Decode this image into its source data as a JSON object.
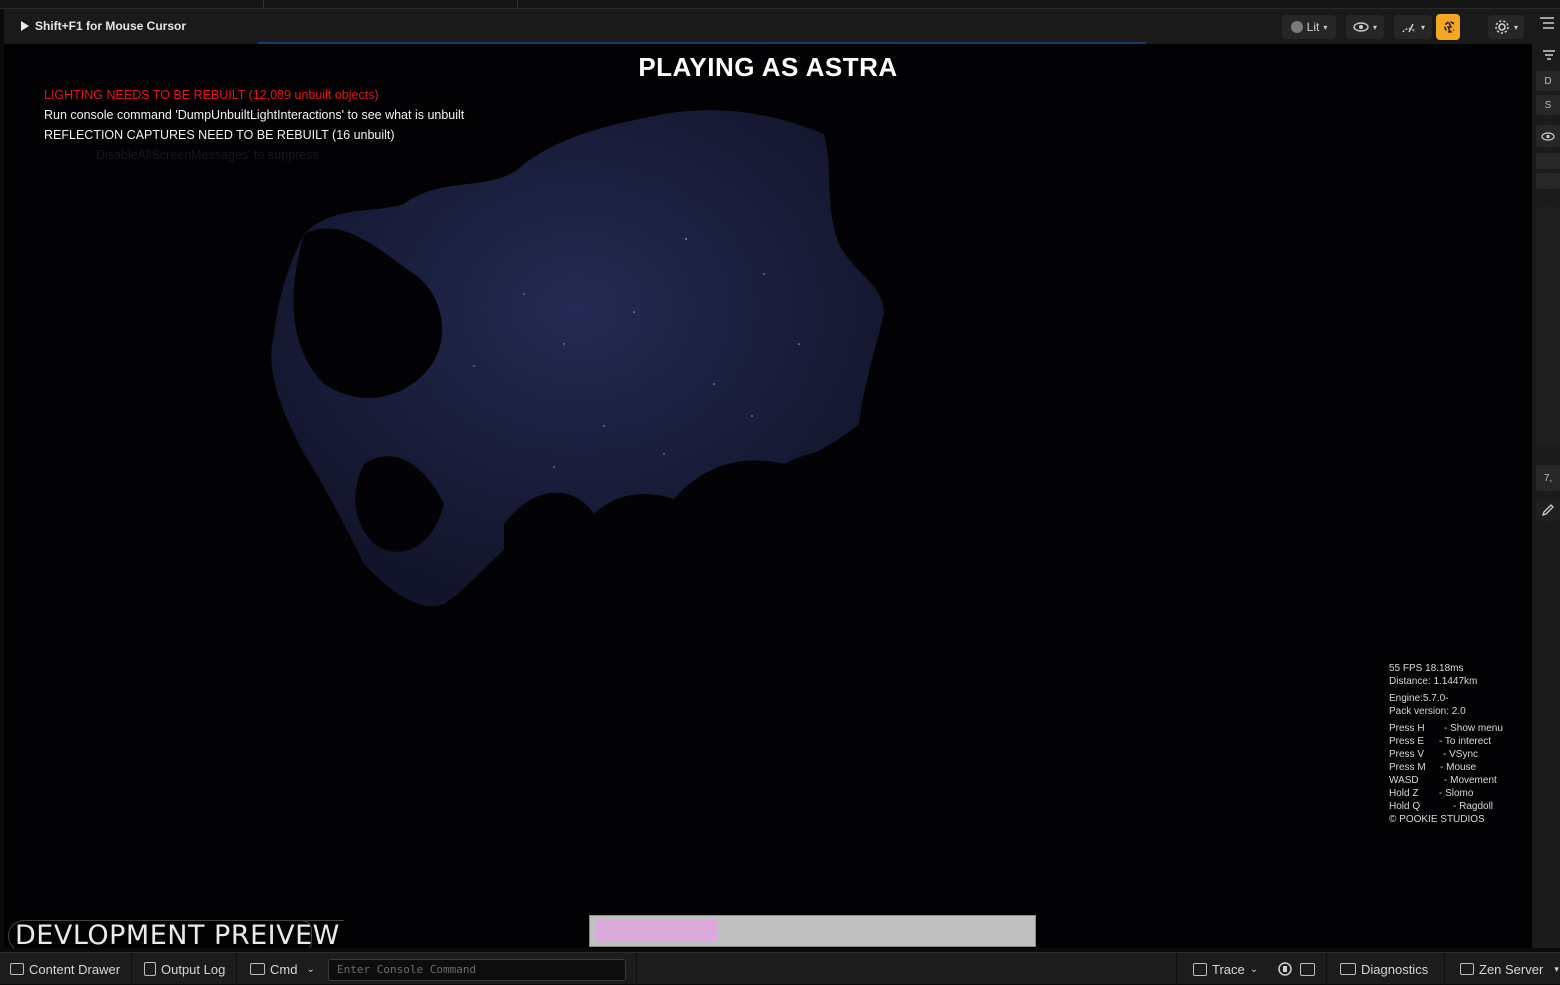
{
  "viewport_toolbar": {
    "hint": "Shift+F1 for Mouse Cursor",
    "view_mode": "Lit"
  },
  "game_hud": {
    "title": "PLAYING AS ASTRA",
    "messages": {
      "lighting": "LIGHTING NEEDS TO BE REBUILT (12,089 unbuilt objects)",
      "console_hint": "Run console command 'DumpUnbuiltLightInteractions' to see what is unbuilt",
      "reflection": "REFLECTION CAPTURES NEED TO BE REBUILT (16 unbuilt)",
      "suppress": "DisableAllScreenMessages' to suppress"
    },
    "stats": {
      "fps": "55 FPS 18.18ms",
      "distance": "Distance: 1.1447km",
      "engine": "Engine:5.7.0-",
      "pack_version": "Pack version: 2.0"
    },
    "controls": [
      {
        "key": "Press H",
        "action": "- Show menu"
      },
      {
        "key": "Press E",
        "action": "- To interect"
      },
      {
        "key": "Press V",
        "action": "- VSync"
      },
      {
        "key": "Press M",
        "action": "- Mouse"
      },
      {
        "key": "WASD",
        "action": "- Movement"
      },
      {
        "key": "Hold Z",
        "action": "- Slomo"
      },
      {
        "key": "Hold Q",
        "action": "- Ragdoll"
      }
    ],
    "copyright": "© POOKIE STUDIOS",
    "dev_label": "DEVLOPMENT PREIVEW",
    "progress": 0.28
  },
  "right_panel": {
    "items": [
      "D",
      "S",
      "7,"
    ]
  },
  "status_bar": {
    "content_drawer": "Content Drawer",
    "output_log": "Output Log",
    "cmd": "Cmd",
    "console_placeholder": "Enter Console Command",
    "trace": "Trace",
    "diagnostics": "Diagnostics",
    "zen_server": "Zen Server"
  },
  "colors": {
    "sky": "#1a1d3a",
    "warning_red": "#e8141c",
    "accent": "#f5a623",
    "progress_fill": "#dba9dc"
  }
}
